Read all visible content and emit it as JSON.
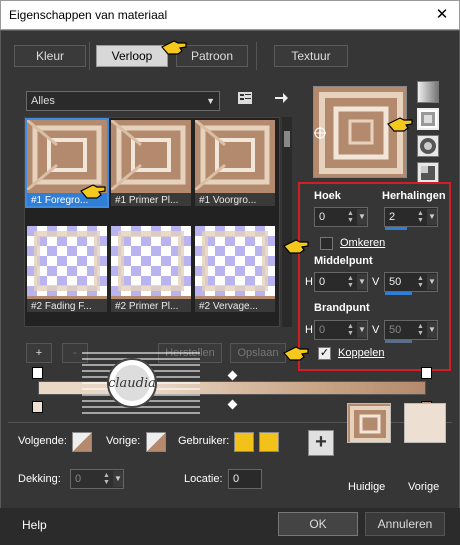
{
  "window": {
    "title": "Eigenschappen van materiaal",
    "close": "✕"
  },
  "tabs": [
    {
      "label": "Kleur"
    },
    {
      "label": "Verloop"
    },
    {
      "label": "Patroon"
    },
    {
      "label": "Textuur"
    }
  ],
  "gallery": {
    "category": "Alles",
    "items": [
      {
        "label": "#1 Foregro...",
        "selected": true
      },
      {
        "label": "#1 Primer Pl..."
      },
      {
        "label": "#1 Voorgro..."
      },
      {
        "label": "#2 Fading F..."
      },
      {
        "label": "#2 Primer Pl..."
      },
      {
        "label": "#2 Vervage..."
      }
    ],
    "add": "+",
    "remove": "-",
    "reset": "Herstellen",
    "save": "Opslaan"
  },
  "settings": {
    "angle_label": "Hoek",
    "angle": "0",
    "repeats_label": "Herhalingen",
    "repeats": "2",
    "invert_label": "Omkeren",
    "invert": false,
    "center_label": "Middelpunt",
    "center_h_label": "H",
    "center_h": "0",
    "center_v_label": "V",
    "center_v": "50",
    "focal_label": "Brandpunt",
    "focal_h_label": "H",
    "focal_h": "0",
    "focal_v_label": "V",
    "focal_v": "50",
    "link_label": "Koppelen",
    "link": true
  },
  "watermark": {
    "text": "claudia"
  },
  "colors": {
    "next_label": "Volgende:",
    "prev_label": "Vorige:",
    "user_label": "Gebruiker:",
    "user_color": "#f2c21b",
    "current_label": "Huidige",
    "previous_label": "Vorige",
    "current_swatch": "#b48a6e",
    "previous_swatch": "#ede0d3",
    "add_symbol": "+"
  },
  "opacity": {
    "label": "Dekking:",
    "value": "0"
  },
  "location": {
    "label": "Locatie:",
    "value": "0"
  },
  "footer": {
    "help": "Help",
    "ok": "OK",
    "cancel": "Annuleren"
  },
  "accent": "#2f7fd8",
  "highlight": "#d21f25"
}
